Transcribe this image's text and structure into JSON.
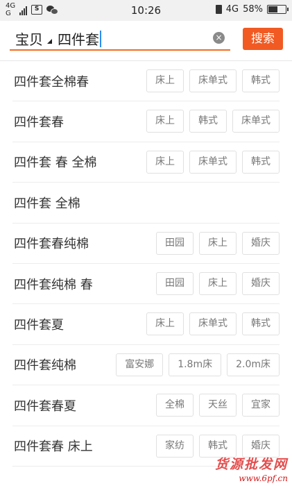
{
  "status_bar": {
    "net_top": "4G",
    "net_bottom": "G",
    "notif_icon_text": "S",
    "time": "10:26",
    "lte": "4G",
    "battery": "58%",
    "battery_level": 0.58
  },
  "search": {
    "scope": "宝贝",
    "query": "四件套",
    "clear_symbol": "×",
    "button_label": "搜索",
    "accent_color": "#f26d20"
  },
  "suggestions": [
    {
      "text": "四件套全棉春",
      "tags": [
        "床上",
        "床单式",
        "韩式"
      ]
    },
    {
      "text": "四件套春",
      "tags": [
        "床上",
        "韩式",
        "床单式"
      ]
    },
    {
      "text": "四件套 春 全棉",
      "tags": [
        "床上",
        "床单式",
        "韩式"
      ]
    },
    {
      "text": "四件套 全棉",
      "tags": []
    },
    {
      "text": "四件套春纯棉",
      "tags": [
        "田园",
        "床上",
        "婚庆"
      ]
    },
    {
      "text": "四件套纯棉 春",
      "tags": [
        "田园",
        "床上",
        "婚庆"
      ]
    },
    {
      "text": "四件套夏",
      "tags": [
        "床上",
        "床单式",
        "韩式"
      ]
    },
    {
      "text": "四件套纯棉",
      "tags": [
        "富安娜",
        "1.8m床",
        "2.0m床"
      ]
    },
    {
      "text": "四件套春夏",
      "tags": [
        "全棉",
        "天丝",
        "宜家"
      ]
    },
    {
      "text": "四件套春 床上",
      "tags": [
        "家纺",
        "韩式",
        "婚庆"
      ]
    }
  ],
  "watermark": {
    "title": "货源批发网",
    "url": "www.6pf.cn"
  }
}
